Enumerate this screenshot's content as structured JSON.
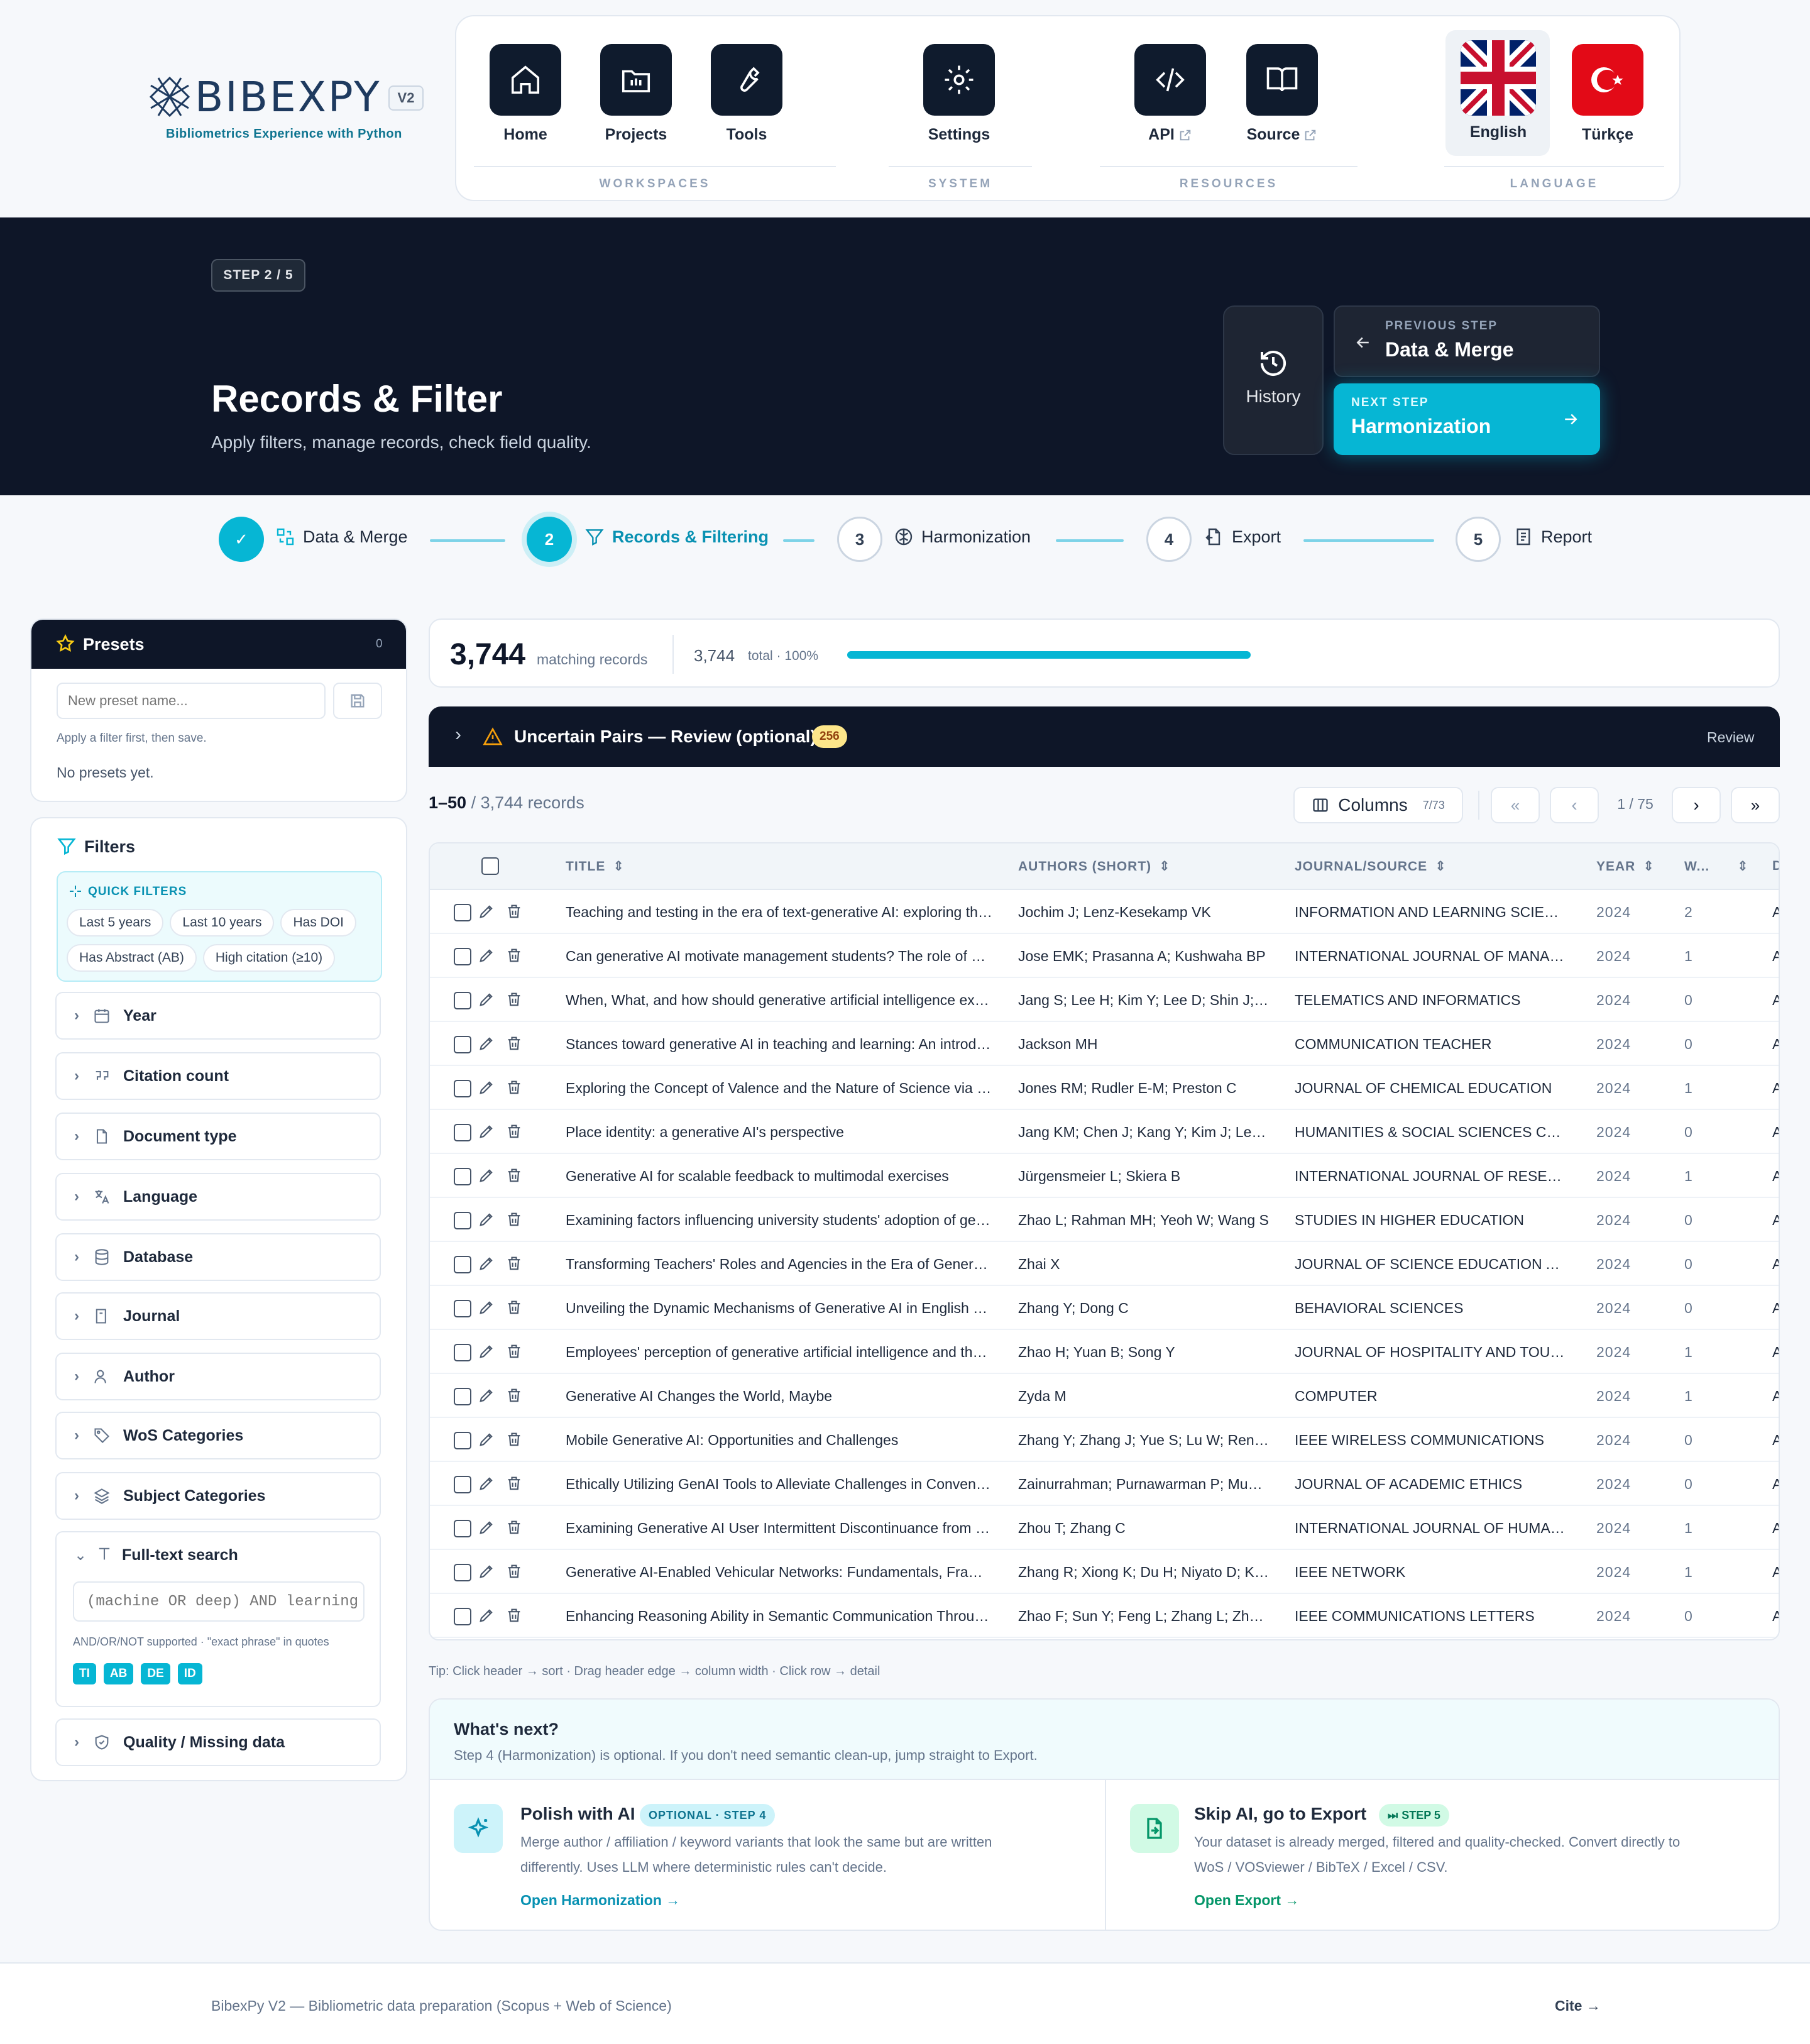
{
  "brand": {
    "name": "BIBEXPY",
    "version": "V2",
    "tagline": "Bibliometrics Experience with Python"
  },
  "nav": {
    "workspaces": {
      "group": "WORKSPACES",
      "items": [
        {
          "label": "Home",
          "icon": "home-icon"
        },
        {
          "label": "Projects",
          "icon": "projects-icon"
        },
        {
          "label": "Tools",
          "icon": "wrench-icon"
        }
      ]
    },
    "system": {
      "group": "SYSTEM",
      "items": [
        {
          "label": "Settings",
          "icon": "gear-icon"
        }
      ]
    },
    "resources": {
      "group": "RESOURCES",
      "items": [
        {
          "label": "API",
          "icon": "code-icon"
        },
        {
          "label": "Source",
          "icon": "book-icon"
        }
      ]
    },
    "language": {
      "group": "LANGUAGE",
      "items": [
        {
          "label": "English",
          "icon": "uk-flag-icon",
          "active": true
        },
        {
          "label": "Türkçe",
          "icon": "tr-flag-icon"
        }
      ]
    }
  },
  "hero": {
    "step_chip": "STEP 2 / 5",
    "title": "Records & Filter",
    "subtitle": "Apply filters, manage records, check field quality.",
    "history_label": "History",
    "prev_caption": "PREVIOUS STEP",
    "prev_title": "Data & Merge",
    "next_caption": "NEXT STEP",
    "next_title": "Harmonization"
  },
  "stepper": [
    {
      "num": "✓",
      "label": "Data & Merge",
      "state": "done"
    },
    {
      "num": "2",
      "label": "Records & Filtering",
      "state": "active"
    },
    {
      "num": "3",
      "label": "Harmonization",
      "state": "todo"
    },
    {
      "num": "4",
      "label": "Export",
      "state": "todo"
    },
    {
      "num": "5",
      "label": "Report",
      "state": "todo"
    }
  ],
  "presets": {
    "title": "Presets",
    "count": "0",
    "placeholder": "New preset name...",
    "hint": "Apply a filter first, then save.",
    "empty": "No presets yet."
  },
  "filters": {
    "title": "Filters",
    "quick_title": "QUICK FILTERS",
    "quick": [
      "Last 5 years",
      "Last 10 years",
      "Has DOI",
      "Has Abstract (AB)",
      "High citation (≥10)"
    ],
    "groups": [
      "Year",
      "Citation count",
      "Document type",
      "Language",
      "Database",
      "Journal",
      "Author",
      "WoS Categories",
      "Subject Categories"
    ],
    "fulltext": {
      "label": "Full-text search",
      "placeholder": "(machine OR deep) AND learning",
      "hint": "AND/OR/NOT supported · \"exact phrase\" in quotes",
      "fields": [
        "TI",
        "AB",
        "DE",
        "ID"
      ]
    },
    "quality": "Quality / Missing data"
  },
  "summary": {
    "matching": "3,744",
    "matching_label": "matching records",
    "total": "3,744",
    "total_label": "total · 100%",
    "fill_fraction": 1.0
  },
  "uncertain": {
    "title": "Uncertain Pairs — Review (optional)",
    "count": "256",
    "action": "Review"
  },
  "table_bar": {
    "range": "1–50",
    "range_rest": "/ 3,744 records",
    "columns_label": "Columns",
    "columns_count": "7/73",
    "page": "1 / 75"
  },
  "table": {
    "headers": [
      "TITLE",
      "AUTHORS (SHORT)",
      "JOURNAL/SOURCE",
      "YEAR",
      "W...",
      "D"
    ],
    "rows": [
      [
        "Teaching and testing in the era of text-generative AI: exploring the needs of students and teachers",
        "Jochim J; Lenz-Kesekamp VK",
        "INFORMATION AND LEARNING SCIENCES",
        "2024",
        "2"
      ],
      [
        "Can generative AI motivate management students? The role of perceived value and information literacy",
        "Jose EMK; Prasanna A; Kushwaha BP",
        "INTERNATIONAL JOURNAL OF MANAGEMENT EDUCATION",
        "2024",
        "1"
      ],
      [
        "When, What, and how should generative artificial intelligence explain to users?",
        "Jang S; Lee H; Kim Y; Lee D; Shin J; Nam J",
        "TELEMATICS AND INFORMATICS",
        "2024",
        "0"
      ],
      [
        "Stances toward generative AI in teaching and learning: An introduction",
        "Jackson MH",
        "COMMUNICATION TEACHER",
        "2024",
        "0"
      ],
      [
        "Exploring the Concept of Valence and the Nature of Science via Generative AI",
        "Jones RM; Rudler E-M; Preston C",
        "JOURNAL OF CHEMICAL EDUCATION",
        "2024",
        "1"
      ],
      [
        "Place identity: a generative AI's perspective",
        "Jang KM; Chen J; Kang Y; Kim J; Lee J; Duarte F",
        "HUMANITIES & SOCIAL SCIENCES COMMUNICATIONS",
        "2024",
        "0"
      ],
      [
        "Generative AI for scalable feedback to multimodal exercises",
        "Jürgensmeier L; Skiera B",
        "INTERNATIONAL JOURNAL OF RESEARCH IN MARKETING",
        "2024",
        "1"
      ],
      [
        "Examining factors influencing university students' adoption of generative AI",
        "Zhao L; Rahman MH; Yeoh W; Wang S",
        "STUDIES IN HIGHER EDUCATION",
        "2024",
        "0"
      ],
      [
        "Transforming Teachers' Roles and Agencies in the Era of Generative AI",
        "Zhai X",
        "JOURNAL OF SCIENCE EDUCATION AND TECHNOLOGY",
        "2024",
        "0"
      ],
      [
        "Unveiling the Dynamic Mechanisms of Generative AI in English Language Learning",
        "Zhang Y; Dong C",
        "BEHAVIORAL SCIENCES",
        "2024",
        "0"
      ],
      [
        "Employees' perception of generative artificial intelligence and the impact on work",
        "Zhao H; Yuan B; Song Y",
        "JOURNAL OF HOSPITALITY AND TOURISM TECHNOLOGY",
        "2024",
        "1"
      ],
      [
        "Generative AI Changes the World, Maybe",
        "Zyda M",
        "COMPUTER",
        "2024",
        "1"
      ],
      [
        "Mobile Generative AI: Opportunities and Challenges",
        "Zhang Y; Zhang J; Yue S; Lu W; Ren J; Shen X",
        "IEEE WIRELESS COMMUNICATIONS",
        "2024",
        "0"
      ],
      [
        "Ethically Utilizing GenAI Tools to Alleviate Challenges in Conventional Feedback",
        "Zainurrahman; Purnawarman P; Muslim AB",
        "JOURNAL OF ACADEMIC ETHICS",
        "2024",
        "0"
      ],
      [
        "Examining Generative AI User Intermittent Discontinuance from a Socio-Technical Perspective",
        "Zhou T; Zhang C",
        "INTERNATIONAL JOURNAL OF HUMAN-COMPUTER INTERACTION",
        "2024",
        "1"
      ],
      [
        "Generative AI-Enabled Vehicular Networks: Fundamentals, Framework, and Case Study",
        "Zhang R; Xiong K; Du H; Niyato D; Kang J",
        "IEEE NETWORK",
        "2024",
        "1"
      ],
      [
        "Enhancing Reasoning Ability in Semantic Communication Through Generative AI",
        "Zhao F; Sun Y; Feng L; Zhang L; Zhao D",
        "IEEE COMMUNICATIONS LETTERS",
        "2024",
        "0"
      ]
    ],
    "d_glyph": "A"
  },
  "tip": "Tip: Click header → sort · Drag header edge → column width · Click row → detail",
  "next": {
    "title": "What's next?",
    "desc": "Step 4 (Harmonization) is optional. If you don't need semantic clean-up, jump straight to Export.",
    "card1": {
      "title": "Polish with AI",
      "badge": "OPTIONAL · STEP 4",
      "desc1": "Merge author / affiliation / keyword variants that look the same but are written",
      "desc2": "differently. Uses LLM where deterministic rules can't decide.",
      "link": "Open Harmonization →"
    },
    "card2": {
      "title": "Skip AI, go to Export",
      "badge": "STEP 5",
      "desc1": "Your dataset is already merged, filtered and quality-checked. Convert directly to",
      "desc2": "WoS / VOSviewer / BibTeX / Excel / CSV.",
      "link": "Open Export →"
    }
  },
  "footer": {
    "text": "BibexPy V2 — Bibliometric data preparation (Scopus + Web of Science)",
    "cite": "Cite →"
  },
  "colors": {
    "accent": "#06b6d4",
    "dark": "#0e1628",
    "green": "#059669"
  }
}
